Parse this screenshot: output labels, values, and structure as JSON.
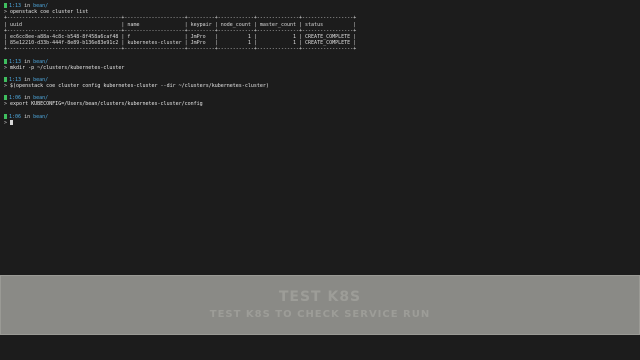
{
  "terminal": {
    "block1": {
      "time": "1:13",
      "in": "in",
      "dir": "bean/",
      "command": "openstack coe cluster list",
      "table": [
        "+--------------------------------------+--------------------+---------+------------+--------------+-----------------+",
        "| uuid                                 | name               | keypair | node_count | master_count | status          |",
        "+--------------------------------------+--------------------+---------+------------+--------------+-----------------+",
        "| ec6cc8ee-a88a-4c8c-b548-8f458a6caf48 | f                  | JmPro   |          1 |            1 | CREATE_COMPLETE |",
        "| 85e12210-d33b-444f-8e89-b136e83e91c2 | kubernetes-cluster | JmPro   |          1 |            1 | CREATE_COMPLETE |",
        "+--------------------------------------+--------------------+---------+------------+--------------+-----------------+"
      ]
    },
    "block2": {
      "time": "1:13",
      "in": "in",
      "dir": "bean/",
      "command": "mkdir -p ~/clusters/kubernetes-cluster"
    },
    "block3": {
      "time": "1:13",
      "in": "in",
      "dir": "bean/",
      "command": "$(openstack coe cluster config kubernetes-cluster --dir ~/clusters/kubernetes-cluster)"
    },
    "block4": {
      "time": "1:06",
      "in": "in",
      "dir": "bean/",
      "command": "export KUBECONFIG=/Users/bean/clusters/kubernetes-cluster/config"
    },
    "block5": {
      "time": "1:06",
      "in": "in",
      "dir": "bean/"
    },
    "arrow": ">"
  },
  "banner": {
    "title": "TEST K8S",
    "subtitle": "TEST K8S TO CHECK SERVICE RUN"
  }
}
